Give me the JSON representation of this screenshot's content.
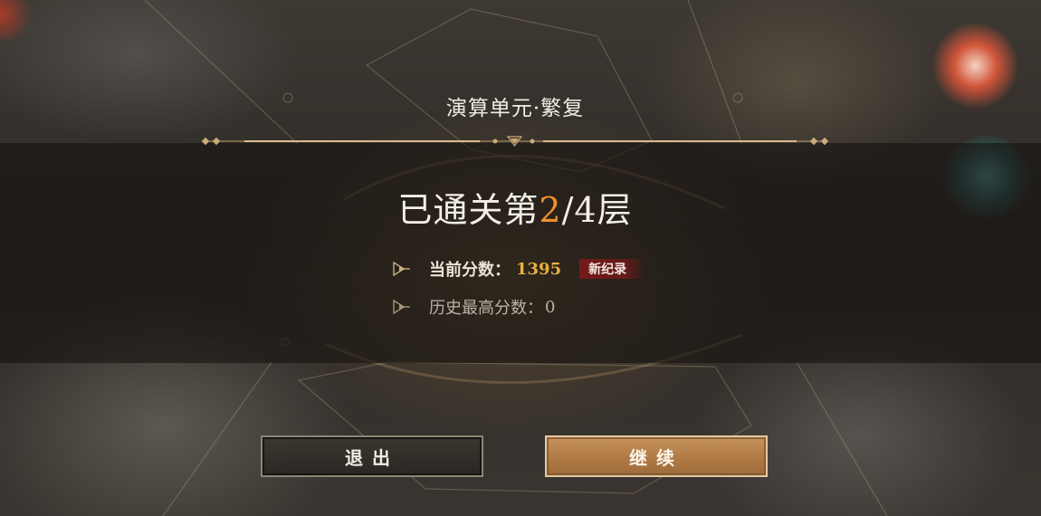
{
  "header": {
    "title": "演算单元·繁复"
  },
  "progress": {
    "prefix": "已通关第",
    "current": "2",
    "suffix": "/4层"
  },
  "stats": [
    {
      "label": "当前分数：",
      "value": "1395",
      "badge": "新纪录"
    },
    {
      "label": "历史最高分数：",
      "value": "0"
    }
  ],
  "buttons": {
    "exit": "退出",
    "continue": "继续"
  },
  "colors": {
    "accent_orange": "#f08f2c",
    "score_gold": "#e8b040",
    "record_red": "#7a1a1a",
    "button_bronze": "#b07a45"
  },
  "icons": {
    "stat_bullet": "play-arrow-icon"
  }
}
